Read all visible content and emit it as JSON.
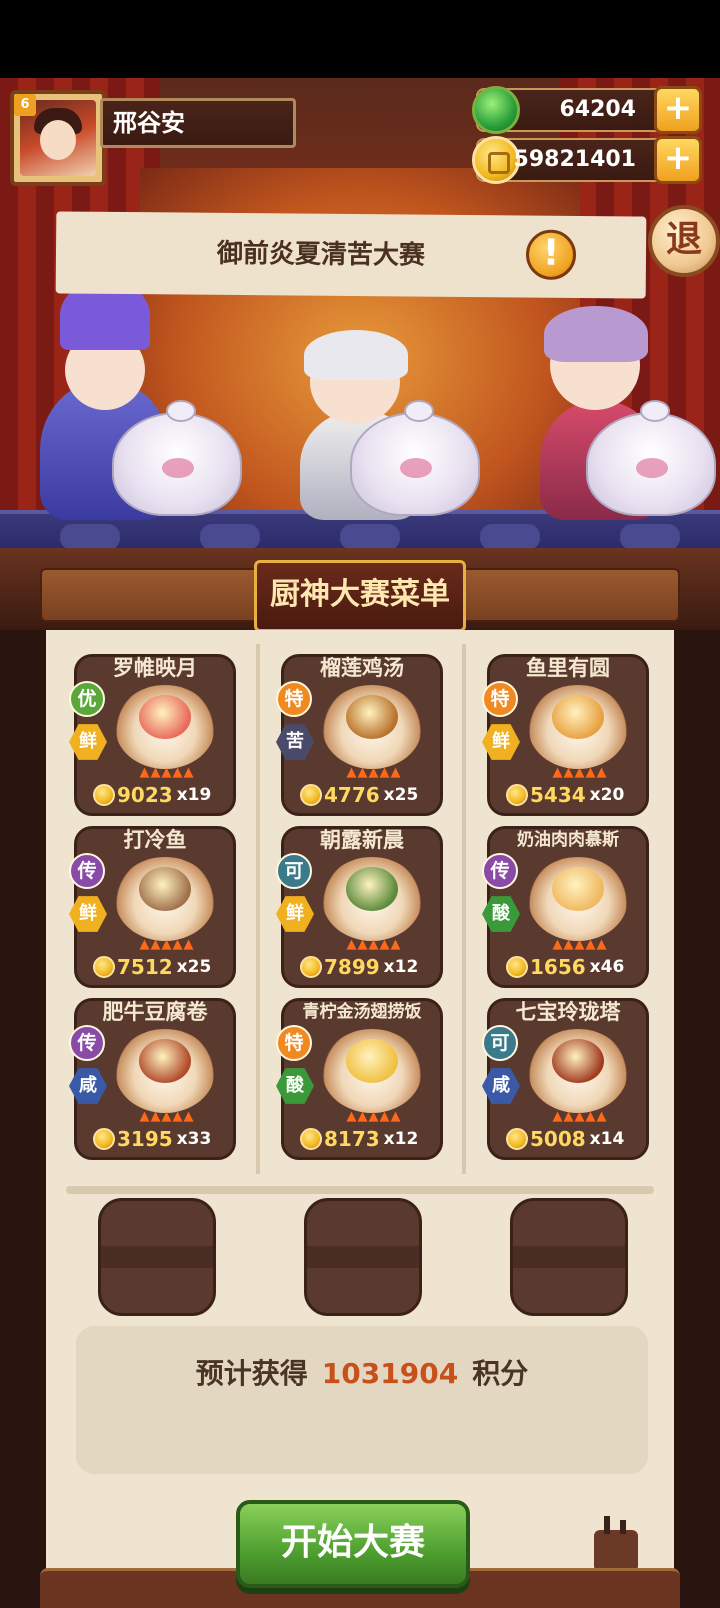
{
  "player": {
    "level": "6",
    "name": "邢谷安"
  },
  "currencies": {
    "jade": "64204",
    "coins": "59821401"
  },
  "event": {
    "title": "御前炎夏清苦大赛",
    "alert": "!"
  },
  "exit_label": "退",
  "menu_title": "厨神大赛菜单",
  "dishes": [
    {
      "name": "罗帷映月",
      "rank": "优",
      "taste": "鲜",
      "price": "9023",
      "qty": "x19",
      "rank_color": "#5aa83a",
      "taste_color": "#f0b020",
      "food_color": "#e86a5a"
    },
    {
      "name": "榴莲鸡汤",
      "rank": "特",
      "taste": "苦",
      "price": "4776",
      "qty": "x25",
      "rank_color": "#f08a20",
      "taste_color": "#4a4a6a",
      "food_color": "#b8702a"
    },
    {
      "name": "鱼里有圆",
      "rank": "特",
      "taste": "鲜",
      "price": "5434",
      "qty": "x20",
      "rank_color": "#f08a20",
      "taste_color": "#f0b020",
      "food_color": "#e8a040"
    },
    {
      "name": "打冷鱼",
      "rank": "传",
      "taste": "鲜",
      "price": "7512",
      "qty": "x25",
      "rank_color": "#8a4aa8",
      "taste_color": "#f0b020",
      "food_color": "#a0704a"
    },
    {
      "name": "朝露新晨",
      "rank": "可",
      "taste": "鲜",
      "price": "7899",
      "qty": "x12",
      "rank_color": "#3a7a8a",
      "taste_color": "#f0b020",
      "food_color": "#5a8a3a"
    },
    {
      "name": "奶油肉肉慕斯",
      "rank": "传",
      "taste": "酸",
      "price": "1656",
      "qty": "x46",
      "rank_color": "#8a4aa8",
      "taste_color": "#3a9a3a",
      "food_color": "#f0b860"
    },
    {
      "name": "肥牛豆腐卷",
      "rank": "传",
      "taste": "咸",
      "price": "3195",
      "qty": "x33",
      "rank_color": "#8a4aa8",
      "taste_color": "#3a5aa8",
      "food_color": "#b04a2a"
    },
    {
      "name": "青柠金汤翅捞饭",
      "rank": "特",
      "taste": "酸",
      "price": "8173",
      "qty": "x12",
      "rank_color": "#f08a20",
      "taste_color": "#3a9a3a",
      "food_color": "#f0c040"
    },
    {
      "name": "七宝玲珑塔",
      "rank": "可",
      "taste": "咸",
      "price": "5008",
      "qty": "x14",
      "rank_color": "#3a7a8a",
      "taste_color": "#3a5aa8",
      "food_color": "#a03a20"
    }
  ],
  "estimate": {
    "label": "预计获得",
    "value": "1031904",
    "unit": "积分"
  },
  "start_button": "开始大赛"
}
